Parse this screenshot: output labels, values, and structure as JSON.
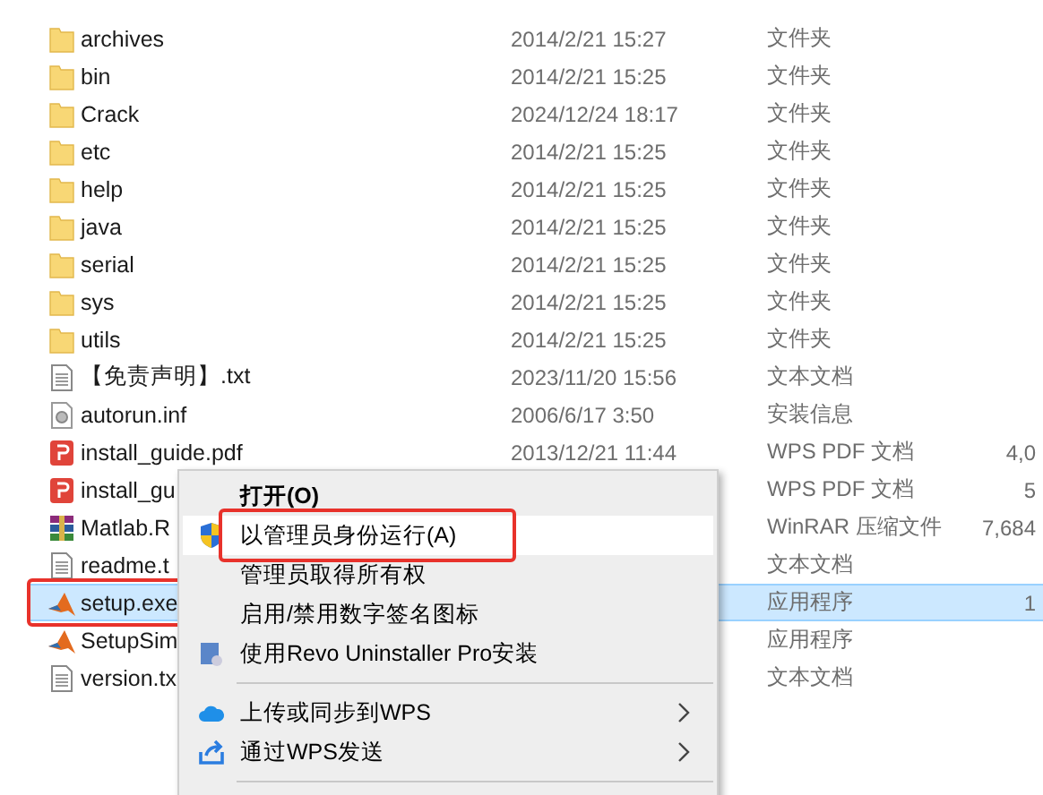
{
  "files": [
    {
      "kind": "folder",
      "name": "archives",
      "date": "2014/2/21 15:27",
      "type": "文件夹",
      "selected": false,
      "marked": false
    },
    {
      "kind": "folder",
      "name": "bin",
      "date": "2014/2/21 15:25",
      "type": "文件夹",
      "selected": false,
      "marked": false
    },
    {
      "kind": "folder",
      "name": "Crack",
      "date": "2024/12/24 18:17",
      "type": "文件夹",
      "selected": false,
      "marked": false
    },
    {
      "kind": "folder",
      "name": "etc",
      "date": "2014/2/21 15:25",
      "type": "文件夹",
      "selected": false,
      "marked": false
    },
    {
      "kind": "folder",
      "name": "help",
      "date": "2014/2/21 15:25",
      "type": "文件夹",
      "selected": false,
      "marked": false
    },
    {
      "kind": "folder",
      "name": "java",
      "date": "2014/2/21 15:25",
      "type": "文件夹",
      "selected": false,
      "marked": false
    },
    {
      "kind": "folder",
      "name": "serial",
      "date": "2014/2/21 15:25",
      "type": "文件夹",
      "selected": false,
      "marked": false
    },
    {
      "kind": "folder",
      "name": "sys",
      "date": "2014/2/21 15:25",
      "type": "文件夹",
      "selected": false,
      "marked": false
    },
    {
      "kind": "folder",
      "name": "utils",
      "date": "2014/2/21 15:25",
      "type": "文件夹",
      "selected": false,
      "marked": false
    },
    {
      "kind": "text",
      "name": "【免责声明】.txt",
      "date": "2023/11/20 15:56",
      "type": "文本文档",
      "selected": false,
      "marked": false
    },
    {
      "kind": "settings",
      "name": "autorun.inf",
      "date": "2006/6/17 3:50",
      "type": "安装信息",
      "selected": false,
      "marked": false
    },
    {
      "kind": "pdf",
      "name": "install_guide.pdf",
      "date": "2013/12/21 11:44",
      "type": "WPS PDF 文档",
      "size": "4,0",
      "selected": false,
      "marked": false
    },
    {
      "kind": "pdf",
      "name": "install_gu",
      "type": "WPS PDF 文档",
      "size": "5",
      "selected": false,
      "marked": false
    },
    {
      "kind": "archive",
      "name": "Matlab.R",
      "type": "WinRAR 压缩文件",
      "size": "7,684",
      "selected": false,
      "marked": false
    },
    {
      "kind": "text",
      "name": "readme.t",
      "type": "文本文档",
      "selected": false,
      "marked": false
    },
    {
      "kind": "matlab",
      "name": "setup.exe",
      "type": "应用程序",
      "size": "1",
      "selected": true,
      "marked": true
    },
    {
      "kind": "matlab",
      "name": "SetupSim",
      "type": "应用程序",
      "selected": false,
      "marked": false
    },
    {
      "kind": "text",
      "name": "version.tx",
      "type": "文本文档",
      "selected": false,
      "marked": false
    }
  ],
  "context_menu": [
    {
      "kind": "plain",
      "label": "打开(O)",
      "default": true,
      "selected": false,
      "submenu": false,
      "marked": false
    },
    {
      "kind": "shield",
      "label": "以管理员身份运行(A)",
      "default": false,
      "selected": true,
      "submenu": false,
      "marked": true
    },
    {
      "kind": "plain",
      "label": "管理员取得所有权",
      "default": false,
      "selected": false,
      "submenu": false,
      "marked": false
    },
    {
      "kind": "plain",
      "label": "启用/禁用数字签名图标",
      "default": false,
      "selected": false,
      "submenu": false,
      "marked": false
    },
    {
      "kind": "installer",
      "label": "使用Revo Uninstaller Pro安装",
      "default": false,
      "selected": false,
      "submenu": false,
      "marked": false
    },
    {
      "kind": "separator"
    },
    {
      "kind": "cloud",
      "label": "上传或同步到WPS",
      "default": false,
      "selected": false,
      "submenu": true,
      "marked": false
    },
    {
      "kind": "share",
      "label": "通过WPS发送",
      "default": false,
      "selected": false,
      "submenu": true,
      "marked": false
    },
    {
      "kind": "separator"
    }
  ]
}
